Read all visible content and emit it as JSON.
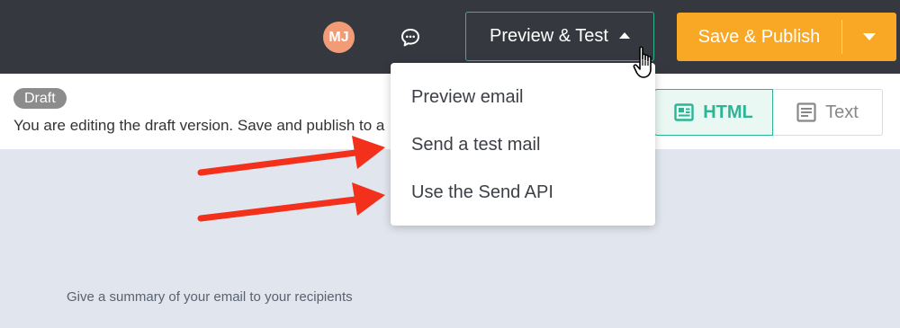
{
  "header": {
    "avatar_initials": "MJ",
    "chat_icon": "chat-bubble-icon",
    "preview_test_label": "Preview & Test",
    "save_publish_label": "Save & Publish"
  },
  "preview_menu": {
    "items": [
      {
        "label": "Preview email"
      },
      {
        "label": "Send a test mail"
      },
      {
        "label": "Use the Send API"
      }
    ]
  },
  "draft_notice": {
    "badge": "Draft",
    "text": "You are editing the draft version. Save and publish to a"
  },
  "format_toggle": {
    "html_label": "HTML",
    "text_label": "Text",
    "selected": "HTML"
  },
  "editor": {
    "summary_placeholder": "Give a summary of your email to your recipients"
  },
  "colors": {
    "topbar": "#35393f",
    "accent_green": "#2bb594",
    "publish_orange": "#f9a825",
    "annotation_arrow": "#f2301b"
  }
}
